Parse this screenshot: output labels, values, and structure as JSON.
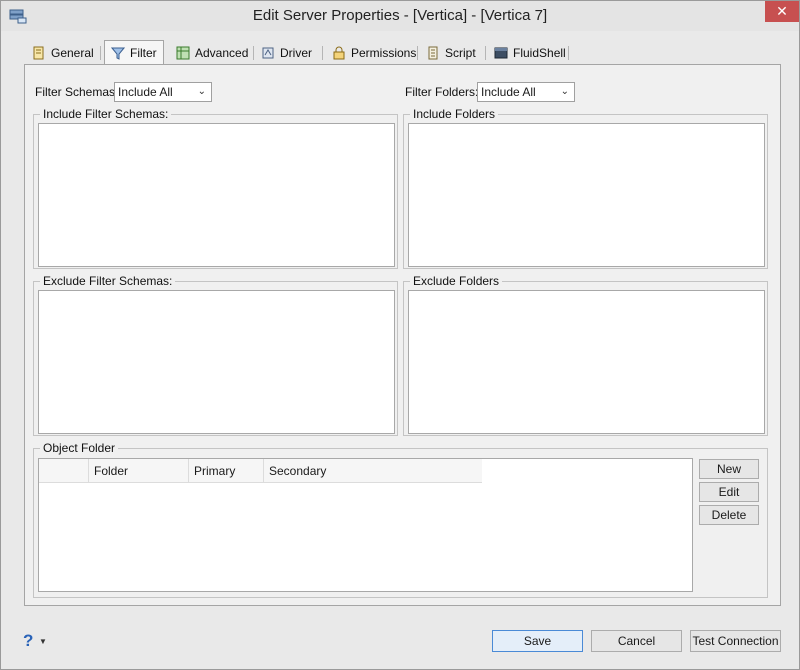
{
  "window": {
    "title": "Edit Server Properties - [Vertica] - [Vertica 7]",
    "close_label": "✕"
  },
  "tabs": [
    {
      "label": "General",
      "icon": "general-icon"
    },
    {
      "label": "Filter",
      "icon": "filter-icon",
      "active": true
    },
    {
      "label": "Advanced",
      "icon": "advanced-icon"
    },
    {
      "label": "Driver",
      "icon": "driver-icon"
    },
    {
      "label": "Permissions",
      "icon": "permissions-icon"
    },
    {
      "label": "Script",
      "icon": "script-icon"
    },
    {
      "label": "FluidShell",
      "icon": "fluidshell-icon"
    }
  ],
  "filter": {
    "schemas_label": "Filter Schemas:",
    "schemas_value": "Include All",
    "folders_label": "Filter Folders:",
    "folders_value": "Include All",
    "include_schemas_title": "Include Filter Schemas:",
    "include_folders_title": "Include Folders",
    "exclude_schemas_title": "Exclude Filter Schemas:",
    "exclude_folders_title": "Exclude Folders"
  },
  "object_folder": {
    "title": "Object Folder",
    "columns": [
      "",
      "Folder",
      "Primary",
      "Secondary"
    ],
    "new_label": "New",
    "edit_label": "Edit",
    "delete_label": "Delete"
  },
  "footer": {
    "help_label": "?",
    "save_label": "Save",
    "cancel_label": "Cancel",
    "test_label": "Test Connection"
  },
  "colors": {
    "close_button": "#c75050",
    "help_icon": "#2a63b8",
    "primary_border": "#4a8ad6"
  }
}
